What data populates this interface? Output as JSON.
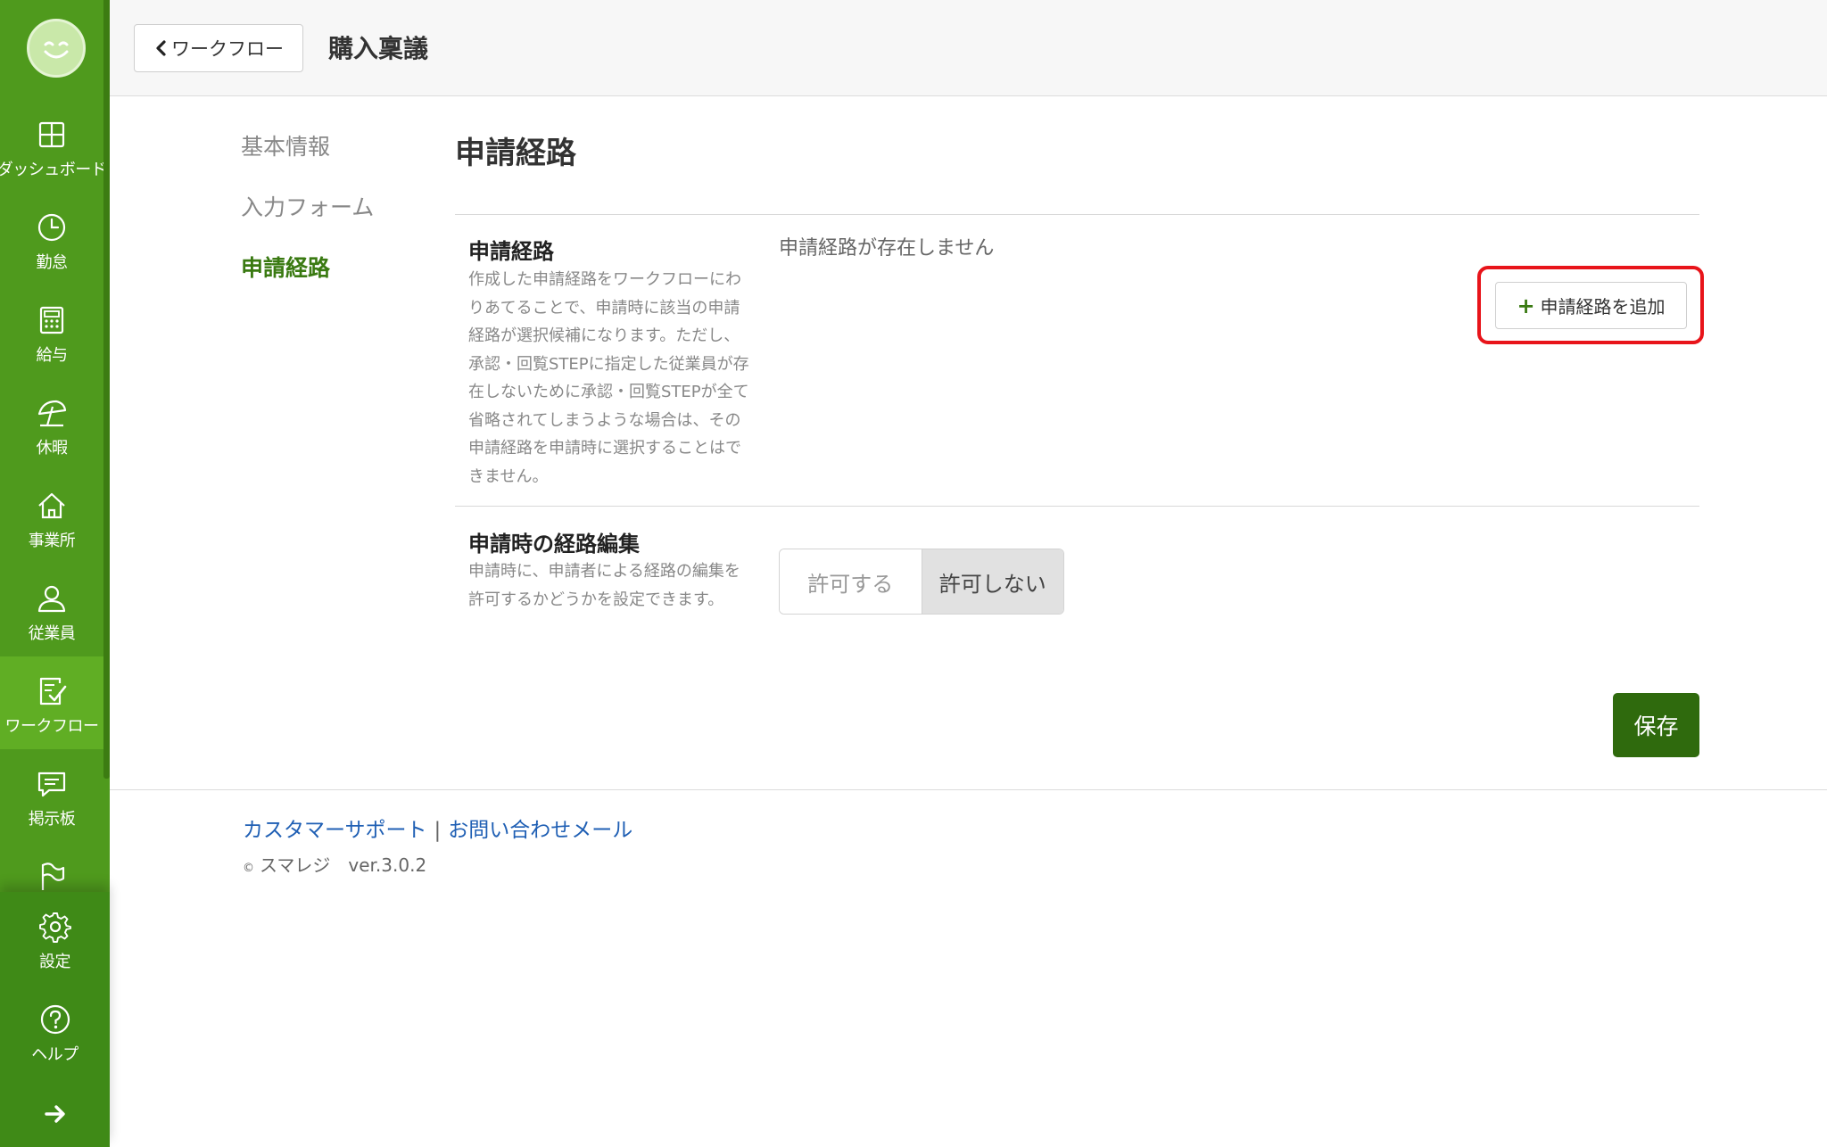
{
  "header": {
    "back_label": "ワークフロー",
    "title": "購入稟議"
  },
  "sidebar": {
    "items": [
      {
        "label": "ダッシュボード",
        "icon": "dashboard-icon"
      },
      {
        "label": "勤怠",
        "icon": "clock-icon"
      },
      {
        "label": "給与",
        "icon": "calculator-icon"
      },
      {
        "label": "休暇",
        "icon": "beach-umbrella-icon"
      },
      {
        "label": "事業所",
        "icon": "home-icon"
      },
      {
        "label": "従業員",
        "icon": "person-icon"
      },
      {
        "label": "ワークフロー",
        "icon": "checklist-icon",
        "active": true
      },
      {
        "label": "掲示板",
        "icon": "message-icon"
      },
      {
        "label": "",
        "icon": "flag-icon"
      }
    ],
    "bottom_items": [
      {
        "label": "設定",
        "icon": "gear-icon"
      },
      {
        "label": "ヘルプ",
        "icon": "help-icon"
      },
      {
        "label": "",
        "icon": "arrow-right-icon"
      }
    ]
  },
  "local_nav": {
    "items": [
      {
        "label": "基本情報"
      },
      {
        "label": "入力フォーム"
      },
      {
        "label": "申請経路",
        "active": true
      }
    ]
  },
  "main": {
    "section_title": "申請経路",
    "route_row": {
      "label": "申請経路",
      "description": "作成した申請経路をワークフローにわりあてることで、申請時に該当の申請経路が選択候補になります。ただし、承認・回覧STEPに指定した従業員が存在しないために承認・回覧STEPが全て省略されてしまうような場合は、その申請経路を申請時に選択することはできません。",
      "empty_text": "申請経路が存在しません",
      "add_button_label": "申請経路を追加"
    },
    "edit_row": {
      "label": "申請時の経路編集",
      "description": "申請時に、申請者による経路の編集を許可するかどうかを設定できます。",
      "options": [
        "許可する",
        "許可しない"
      ],
      "selected": "許可しない"
    },
    "save_label": "保存"
  },
  "footer": {
    "support_link": "カスタマーサポート",
    "separator": "|",
    "contact_link": "お問い合わせメール",
    "copyright_mark": "©",
    "company": "スマレジ",
    "version": "ver.3.0.2"
  },
  "colors": {
    "sidebar": "#4f9a1d",
    "sidebar_active": "#60ae24",
    "accent_green": "#3a7a12",
    "save_button": "#2f6a0d",
    "highlight_red": "#e8141a",
    "link_blue": "#1f5fb4"
  }
}
